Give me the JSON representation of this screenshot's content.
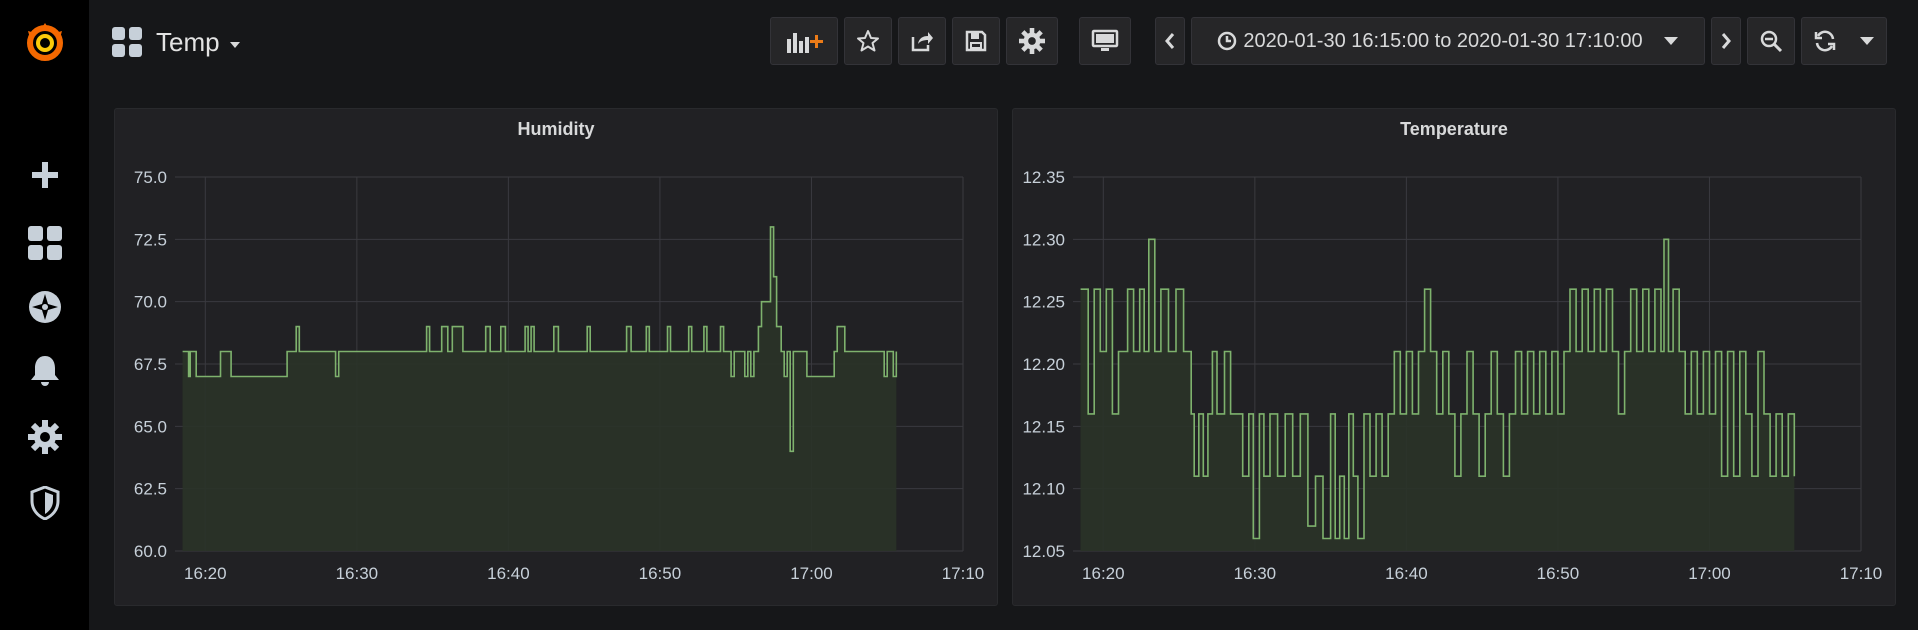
{
  "dashboard": {
    "title": "Temp"
  },
  "toolbar": {
    "icons": [
      "add-panel-icon",
      "star-icon",
      "share-icon",
      "save-icon",
      "settings-icon",
      "tv-mode-icon",
      "chevron-left-icon",
      "clock-icon",
      "chevron-down-icon",
      "chevron-right-icon",
      "zoom-out-icon",
      "refresh-icon",
      "chevron-down-icon"
    ],
    "time_range": "2020-01-30 16:15:00 to 2020-01-30 17:10:00"
  },
  "sidemenu": {
    "icons": [
      "grafana-logo-icon",
      "plus-icon",
      "dashboards-icon",
      "explore-icon",
      "alerting-icon",
      "configuration-icon",
      "shield-icon"
    ]
  },
  "colors": {
    "series": "#7eb26d",
    "fill": "#2a3328",
    "grid": "#3a3a3f",
    "panel_bg": "#212124",
    "page_bg": "#161719",
    "accent": "#f46800"
  },
  "chart_data": [
    {
      "type": "line",
      "title": "Humidity",
      "xlabel": "",
      "ylabel": "",
      "x_ticks": [
        "16:20",
        "16:30",
        "16:40",
        "16:50",
        "17:00",
        "17:10"
      ],
      "y_ticks": [
        "75.0",
        "72.5",
        "70.0",
        "67.5",
        "65.0",
        "62.5",
        "60.0"
      ],
      "xlim": [
        "16:18",
        "17:10"
      ],
      "ylim": [
        60,
        75
      ],
      "grid": true,
      "fill": true,
      "step": true,
      "series": [
        {
          "x": [
            "16:18.5",
            "16:18.9",
            "16:19.0",
            "16:19.4",
            "16:19.6",
            "16:20.9",
            "16:21.0",
            "16:21.5",
            "16:21.7",
            "16:25.4",
            "16:26.0",
            "16:26.2",
            "16:26.4",
            "16:28.6",
            "16:28.8",
            "16:34.6",
            "16:34.8",
            "16:35.6",
            "16:36.0",
            "16:36.3",
            "16:36.8",
            "16:37.0",
            "16:38.5",
            "16:38.8",
            "16:39.5",
            "16:39.8",
            "16:41.1",
            "16:41.3",
            "16:41.5",
            "16:41.7",
            "16:43.0",
            "16:43.3",
            "16:45.2",
            "16:45.4",
            "16:47.8",
            "16:48.1",
            "16:49.1",
            "16:49.3",
            "16:50.5",
            "16:50.7",
            "16:51.9",
            "16:52.1",
            "16:52.9",
            "16:53.1",
            "16:54.0",
            "16:54.2",
            "16:54.7",
            "16:54.9",
            "16:55.6",
            "16:55.8",
            "16:56.0",
            "16:56.2",
            "16:56.5",
            "16:56.7",
            "16:57.3",
            "16:57.5",
            "16:57.7",
            "16:58.0",
            "16:58.2",
            "16:58.4",
            "16:58.6",
            "16:58.8",
            "16:59.5",
            "16:59.7",
            "17:01.5",
            "17:01.7",
            "17:02.2",
            "17:02.4",
            "17:04.8",
            "17:05.0",
            "17:05.4",
            "17:05.6"
          ],
          "y": [
            68,
            67,
            68,
            67,
            67,
            67,
            68,
            68,
            67,
            68,
            69,
            68,
            68,
            67,
            68,
            69,
            68,
            69,
            68,
            69,
            69,
            68,
            69,
            68,
            69,
            68,
            69,
            68,
            69,
            68,
            69,
            68,
            69,
            68,
            69,
            68,
            69,
            68,
            69,
            68,
            69,
            68,
            69,
            68,
            69,
            68,
            67,
            68,
            67,
            68,
            67,
            68,
            69,
            70,
            73,
            71,
            69,
            68,
            67,
            68,
            64,
            68,
            68,
            67,
            68,
            69,
            68,
            68,
            67,
            68,
            67,
            68
          ]
        }
      ]
    },
    {
      "type": "line",
      "title": "Temperature",
      "xlabel": "",
      "ylabel": "",
      "x_ticks": [
        "16:20",
        "16:30",
        "16:40",
        "16:50",
        "17:00",
        "17:10"
      ],
      "y_ticks": [
        "12.35",
        "12.30",
        "12.25",
        "12.20",
        "12.15",
        "12.10",
        "12.05"
      ],
      "xlim": [
        "16:18",
        "17:10"
      ],
      "ylim": [
        12.05,
        12.35
      ],
      "grid": true,
      "fill": true,
      "step": true,
      "series": [
        {
          "x": [
            "16:18.5",
            "16:19.0",
            "16:19.4",
            "16:19.8",
            "16:20.2",
            "16:20.6",
            "16:21.0",
            "16:21.6",
            "16:22.0",
            "16:22.4",
            "16:22.7",
            "16:23.0",
            "16:23.4",
            "16:23.8",
            "16:24.3",
            "16:24.8",
            "16:25.3",
            "16:25.8",
            "16:26.0",
            "16:26.3",
            "16:26.6",
            "16:26.9",
            "16:27.2",
            "16:27.5",
            "16:28.0",
            "16:28.4",
            "16:28.8",
            "16:29.2",
            "16:29.6",
            "16:29.9",
            "16:30.3",
            "16:30.6",
            "16:31.0",
            "16:31.5",
            "16:32.0",
            "16:32.5",
            "16:33.0",
            "16:33.5",
            "16:34.0",
            "16:34.5",
            "16:35.0",
            "16:35.3",
            "16:35.6",
            "16:35.9",
            "16:36.2",
            "16:36.5",
            "16:36.8",
            "16:37.2",
            "16:37.6",
            "16:38.0",
            "16:38.4",
            "16:38.8",
            "16:39.2",
            "16:39.6",
            "16:40.0",
            "16:40.4",
            "16:40.8",
            "16:41.2",
            "16:41.6",
            "16:42.0",
            "16:42.4",
            "16:42.8",
            "16:43.2",
            "16:43.6",
            "16:44.0",
            "16:44.4",
            "16:44.8",
            "16:45.2",
            "16:45.6",
            "16:46.0",
            "16:46.4",
            "16:46.8",
            "16:47.2",
            "16:47.6",
            "16:48.0",
            "16:48.4",
            "16:48.8",
            "16:49.2",
            "16:49.6",
            "16:50.0",
            "16:50.4",
            "16:50.8",
            "16:51.2",
            "16:51.6",
            "16:52.0",
            "16:52.4",
            "16:52.8",
            "16:53.2",
            "16:53.6",
            "16:54.0",
            "16:54.4",
            "16:54.8",
            "16:55.2",
            "16:55.6",
            "16:56.0",
            "16:56.4",
            "16:56.8",
            "16:57.0",
            "16:57.3",
            "16:57.6",
            "16:58.0",
            "16:58.4",
            "16:58.8",
            "16:59.2",
            "16:59.6",
            "17:00.0",
            "17:00.4",
            "17:00.8",
            "17:01.2",
            "17:01.6",
            "17:02.0",
            "17:02.4",
            "17:02.8",
            "17:03.2",
            "17:03.6",
            "17:04.0",
            "17:04.4",
            "17:04.8",
            "17:05.2",
            "17:05.6"
          ],
          "y": [
            12.26,
            12.16,
            12.26,
            12.21,
            12.26,
            12.16,
            12.21,
            12.26,
            12.21,
            12.26,
            12.21,
            12.3,
            12.21,
            12.26,
            12.21,
            12.26,
            12.21,
            12.16,
            12.11,
            12.16,
            12.11,
            12.16,
            12.21,
            12.16,
            12.21,
            12.16,
            12.16,
            12.11,
            12.16,
            12.06,
            12.16,
            12.11,
            12.16,
            12.11,
            12.16,
            12.11,
            12.16,
            12.07,
            12.11,
            12.06,
            12.16,
            12.06,
            12.11,
            12.06,
            12.16,
            12.11,
            12.06,
            12.16,
            12.11,
            12.16,
            12.11,
            12.16,
            12.21,
            12.16,
            12.21,
            12.16,
            12.21,
            12.26,
            12.21,
            12.16,
            12.21,
            12.16,
            12.11,
            12.16,
            12.21,
            12.16,
            12.11,
            12.16,
            12.21,
            12.16,
            12.11,
            12.16,
            12.21,
            12.16,
            12.21,
            12.16,
            12.21,
            12.16,
            12.21,
            12.16,
            12.21,
            12.26,
            12.21,
            12.26,
            12.21,
            12.26,
            12.21,
            12.26,
            12.21,
            12.16,
            12.21,
            12.26,
            12.21,
            12.26,
            12.21,
            12.26,
            12.21,
            12.3,
            12.21,
            12.26,
            12.21,
            12.16,
            12.21,
            12.16,
            12.21,
            12.16,
            12.21,
            12.11,
            12.21,
            12.11,
            12.21,
            12.16,
            12.11,
            12.21,
            12.16,
            12.11,
            12.16,
            12.11,
            12.16,
            12.11
          ]
        }
      ]
    }
  ]
}
